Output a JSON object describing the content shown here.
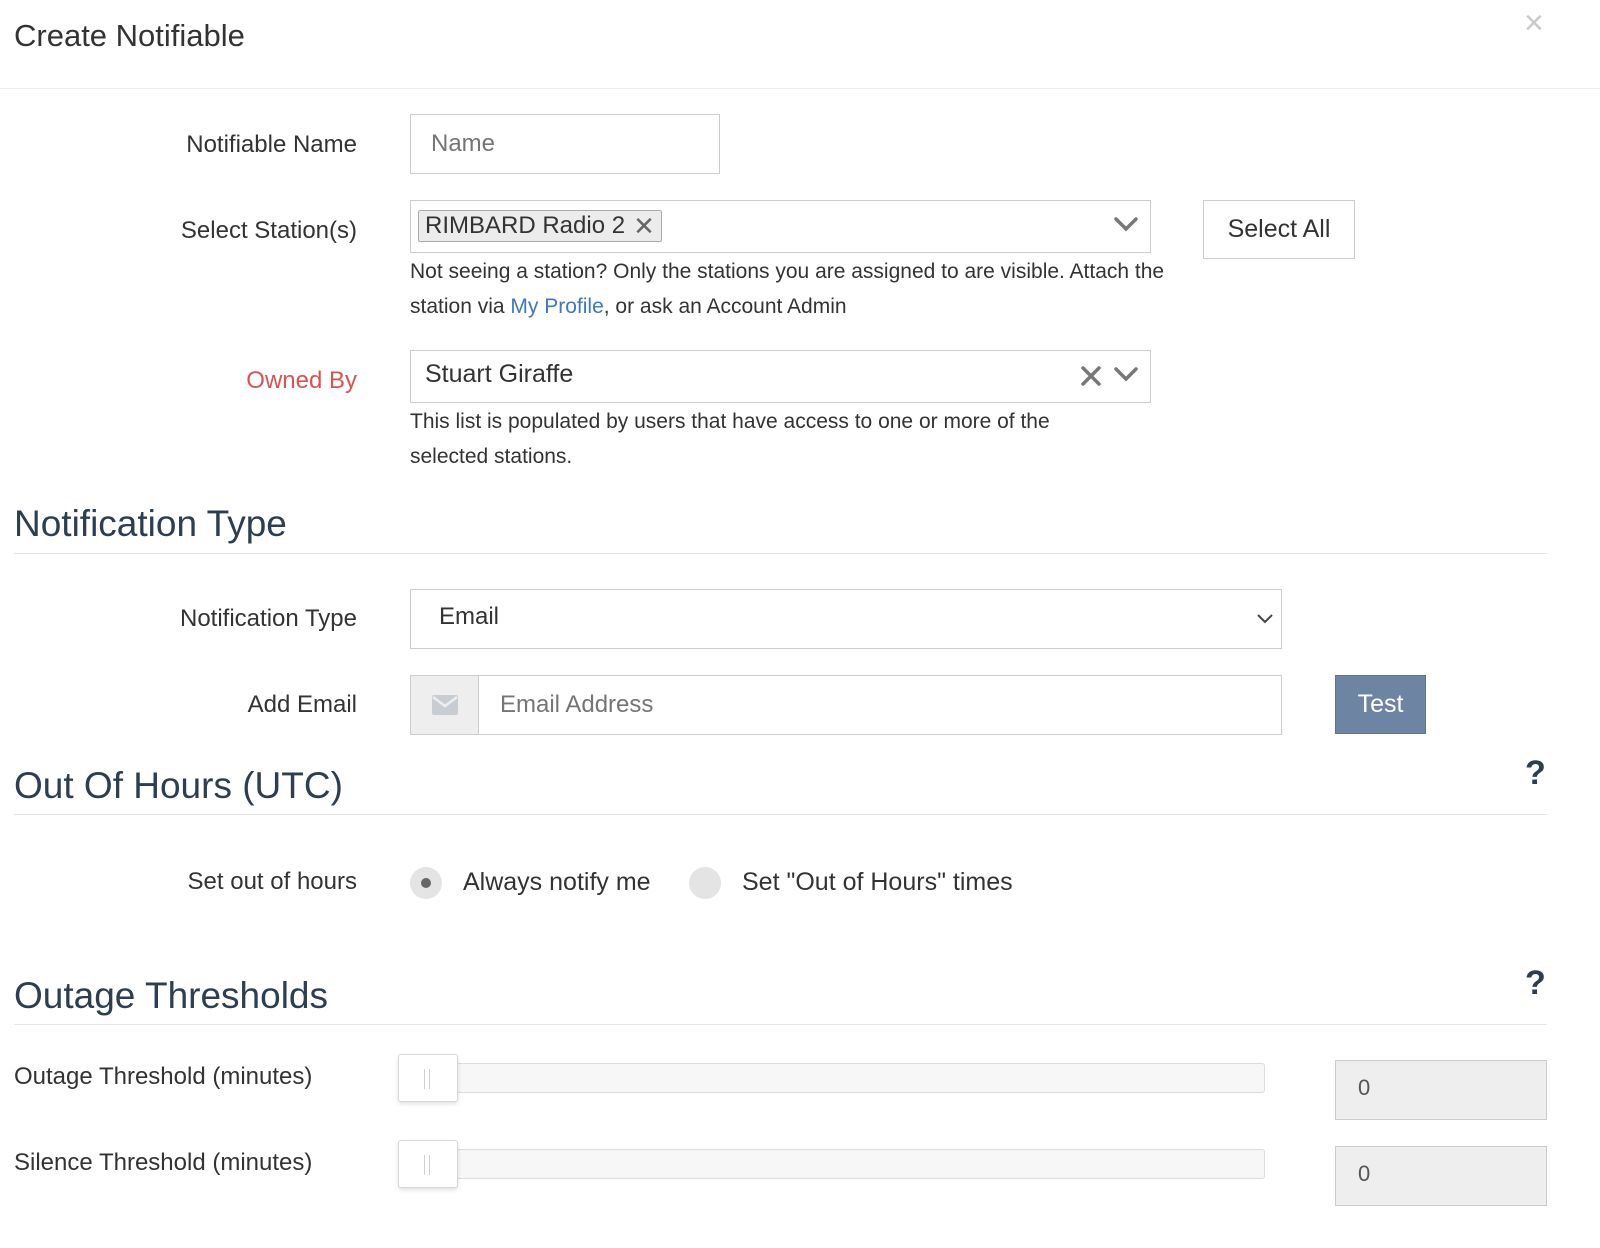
{
  "modal": {
    "title": "Create Notifiable",
    "close_label": "×"
  },
  "notifiable_name": {
    "label": "Notifiable Name",
    "placeholder": "Name",
    "value": ""
  },
  "stations": {
    "label": "Select Station(s)",
    "selected": [
      "RIMBARD Radio 2"
    ],
    "select_all_label": "Select All",
    "help_prefix": "Not seeing a station? Only the stations you are assigned to are visible. Attach the station via ",
    "help_link": "My Profile",
    "help_suffix": ", or ask an Account Admin"
  },
  "owned_by": {
    "label": "Owned By",
    "value": "Stuart Giraffe",
    "help": "This list is populated by users that have access to one or more of the selected stations."
  },
  "notification_type_section": {
    "title": "Notification Type",
    "type_label": "Notification Type",
    "type_value": "Email",
    "add_email_label": "Add Email",
    "email_placeholder": "Email Address",
    "test_label": "Test"
  },
  "out_of_hours": {
    "title": "Out Of Hours (UTC)",
    "help_icon": "?",
    "label": "Set out of hours",
    "options": [
      "Always notify me",
      "Set \"Out of Hours\" times"
    ],
    "selected_index": 0
  },
  "outage_thresholds": {
    "title": "Outage Thresholds",
    "help_icon": "?",
    "outage": {
      "label": "Outage Threshold (minutes)",
      "value": "0"
    },
    "silence": {
      "label": "Silence Threshold (minutes)",
      "value": "0"
    }
  },
  "icons": [
    "close-icon",
    "remove-tag-icon",
    "chevron-down-icon",
    "clear-icon",
    "envelope-icon",
    "help-icon"
  ]
}
